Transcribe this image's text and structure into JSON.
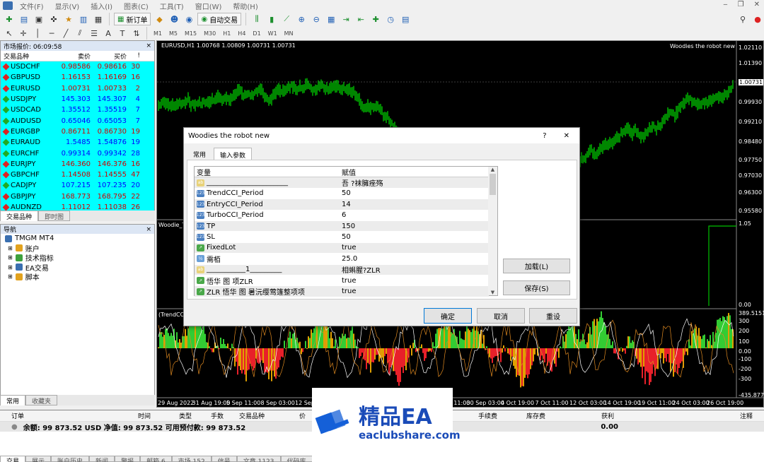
{
  "menu": {
    "items": [
      "文件(F)",
      "显示(V)",
      "插入(I)",
      "图表(C)",
      "工具(T)",
      "窗口(W)",
      "帮助(H)"
    ]
  },
  "toolbar": {
    "new_order": "新订单",
    "auto_trade": "自动交易"
  },
  "timeframes": [
    "M1",
    "M5",
    "M15",
    "M30",
    "H1",
    "H4",
    "D1",
    "W1",
    "MN"
  ],
  "market_watch": {
    "title": "市场报价: 06:09:58",
    "col_symbol": "交易品种",
    "col_bid": "卖价",
    "col_ask": "买价",
    "col_spread": "!",
    "rows": [
      {
        "symbol": "USDCHF",
        "bid": "0.98586",
        "ask": "0.98616",
        "spread": "30",
        "dir": "dn"
      },
      {
        "symbol": "GBPUSD",
        "bid": "1.16153",
        "ask": "1.16169",
        "spread": "16",
        "dir": "dn"
      },
      {
        "symbol": "EURUSD",
        "bid": "1.00731",
        "ask": "1.00733",
        "spread": "2",
        "dir": "dn"
      },
      {
        "symbol": "USDJPY",
        "bid": "145.303",
        "ask": "145.307",
        "spread": "4",
        "dir": "up"
      },
      {
        "symbol": "USDCAD",
        "bid": "1.35512",
        "ask": "1.35519",
        "spread": "7",
        "dir": "up"
      },
      {
        "symbol": "AUDUSD",
        "bid": "0.65046",
        "ask": "0.65053",
        "spread": "7",
        "dir": "up"
      },
      {
        "symbol": "EURGBP",
        "bid": "0.86711",
        "ask": "0.86730",
        "spread": "19",
        "dir": "dn"
      },
      {
        "symbol": "EURAUD",
        "bid": "1.5485",
        "ask": "1.54876",
        "spread": "19",
        "dir": "up"
      },
      {
        "symbol": "EURCHF",
        "bid": "0.99314",
        "ask": "0.99342",
        "spread": "28",
        "dir": "up"
      },
      {
        "symbol": "EURJPY",
        "bid": "146.360",
        "ask": "146.376",
        "spread": "16",
        "dir": "dn"
      },
      {
        "symbol": "GBPCHF",
        "bid": "1.14508",
        "ask": "1.14555",
        "spread": "47",
        "dir": "dn"
      },
      {
        "symbol": "CADJPY",
        "bid": "107.215",
        "ask": "107.235",
        "spread": "20",
        "dir": "up"
      },
      {
        "symbol": "GBPJPY",
        "bid": "168.773",
        "ask": "168.795",
        "spread": "22",
        "dir": "dn"
      },
      {
        "symbol": "AUDNZD",
        "bid": "1.11012",
        "ask": "1.11038",
        "spread": "26",
        "dir": "dn"
      }
    ],
    "tab_symbols": "交易品种",
    "tab_ticks": "即时图"
  },
  "navigator": {
    "title": "导航",
    "root": "TMGM MT4",
    "items": [
      "账户",
      "技术指标",
      "EA交易",
      "脚本"
    ],
    "tab_common": "常用",
    "tab_fav": "收藏夹"
  },
  "chart": {
    "header": "EURUSD,H1  1.00768 1.00809 1.00731 1.00731",
    "ea_label": "Woodies the robot new",
    "price_ticks": [
      "1.02110",
      "1.01390",
      "1.00731",
      "0.99930",
      "0.99210",
      "0.98480",
      "0.97750",
      "0.97030",
      "0.96300",
      "0.95580"
    ],
    "woodie_label": "Woodie_Tr",
    "woodie_ticks": [
      "1.05",
      "0.00"
    ],
    "cci_label": "(TrendCCI",
    "cci_ticks": [
      "389.5151",
      "300",
      "200",
      "100",
      "0.00",
      "-100",
      "-200",
      "-300",
      "-435.8771"
    ],
    "time_ticks": [
      "29 Aug 2022",
      "31 Aug 19:00",
      "5 Sep 11:00",
      "8 Sep 03:00",
      "12 Sep 19:00",
      "15 Sep 11:00",
      "20 Sep 03:00",
      "22 Sep 19:00",
      "27 Sep 11:00",
      "30 Sep 03:00",
      "4 Oct 19:00",
      "7 Oct 11:00",
      "12 Oct 03:00",
      "14 Oct 19:00",
      "19 Oct 11:00",
      "24 Oct 03:00",
      "26 Oct 19:00"
    ]
  },
  "dialog": {
    "title": "Woodies the robot new",
    "help": "?",
    "close": "✕",
    "tab_common": "常用",
    "tab_inputs": "输入参数",
    "col_var": "变量",
    "col_val": "赋值",
    "params": [
      {
        "icon": "ab",
        "name": "_______________________",
        "value": "吾    ?袜臃痤殇"
      },
      {
        "icon": "123",
        "name": "TrendCCI_Period",
        "value": "50"
      },
      {
        "icon": "123",
        "name": "EntryCCI_Period",
        "value": "14"
      },
      {
        "icon": "123",
        "name": "TurboCCI_Period",
        "value": "6"
      },
      {
        "icon": "123",
        "name": "TP",
        "value": "150"
      },
      {
        "icon": "123",
        "name": "SL",
        "value": "50"
      },
      {
        "icon": "bool",
        "name": "FixedLot",
        "value": "true"
      },
      {
        "icon": "v2",
        "name": "需栢",
        "value": "25.0"
      },
      {
        "icon": "ab",
        "name": "___________1_________",
        "value": "相蝌腥?ZLR"
      },
      {
        "icon": "bool",
        "name": "悟华   图       项ZLR",
        "value": "true"
      },
      {
        "icon": "bool",
        "name": "ZLR 悟华   图      暑沅缨莺篷整项项",
        "value": "true"
      }
    ],
    "load": "加载(L)",
    "save": "保存(S)",
    "ok": "确定",
    "cancel": "取消",
    "reset": "重设"
  },
  "terminal": {
    "cols": [
      "订单",
      "时间",
      "类型",
      "手数",
      "交易品种",
      "价",
      "",
      "手续费",
      "库存费",
      "获利",
      "注释"
    ],
    "balance": "余额: 99 873.52 USD  净值: 99 873.52  可用预付款: 99 873.52",
    "profit": "0.00",
    "tabs": [
      "交易",
      "展示",
      "账户历史",
      "新闻",
      "警报",
      "邮箱 6",
      "市场 152",
      "信号",
      "文章 1123",
      "代码库",
      "EA",
      "日志"
    ]
  },
  "watermark": {
    "brand": "精品EA",
    "url": "eaclubshare.com"
  },
  "colors": {
    "cyan": "#00ffff",
    "bull": "#00c000",
    "cci_up": "#33cc33",
    "cci_dn": "#e8202a"
  }
}
